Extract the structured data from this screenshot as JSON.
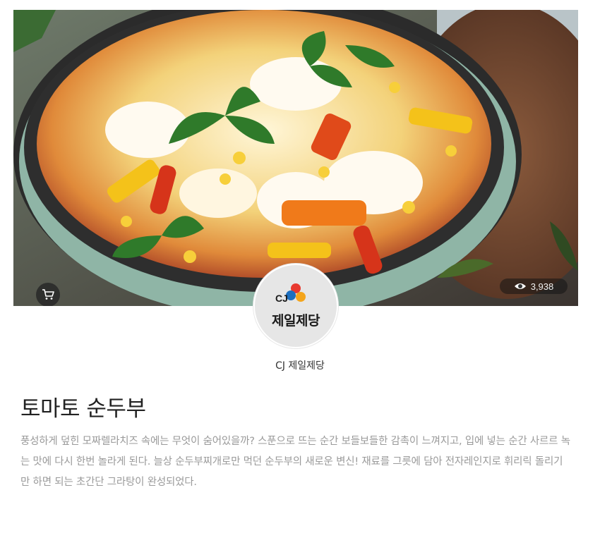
{
  "hero": {
    "image_alt": "토마토 순두부",
    "view_count": "3,938"
  },
  "icons": {
    "cart": "cart-icon",
    "views": "eye-icon"
  },
  "brand": {
    "logo_mark": "CJ",
    "logo_name": "제일제당",
    "name": "CJ 제일제당",
    "colors": {
      "red": "#e8392f",
      "blue": "#1c6fc0",
      "orange": "#f4a51c"
    }
  },
  "recipe": {
    "title": "토마토 순두부",
    "description": "풍성하게 덮힌 모짜렐라치즈 속에는 무엇이 숨어있을까? 스푼으로 뜨는 순간 보들보들한 감촉이 느껴지고, 입에 넣는 순간 사르르 녹는 맛에 다시 한번 놀라게 된다. 늘상 순두부찌개로만 먹던 순두부의 새로운 변신! 재료를 그릇에 담아 전자레인지로 휘리릭 돌리기만 하면 되는 초간단 그라탕이 완성되었다."
  }
}
